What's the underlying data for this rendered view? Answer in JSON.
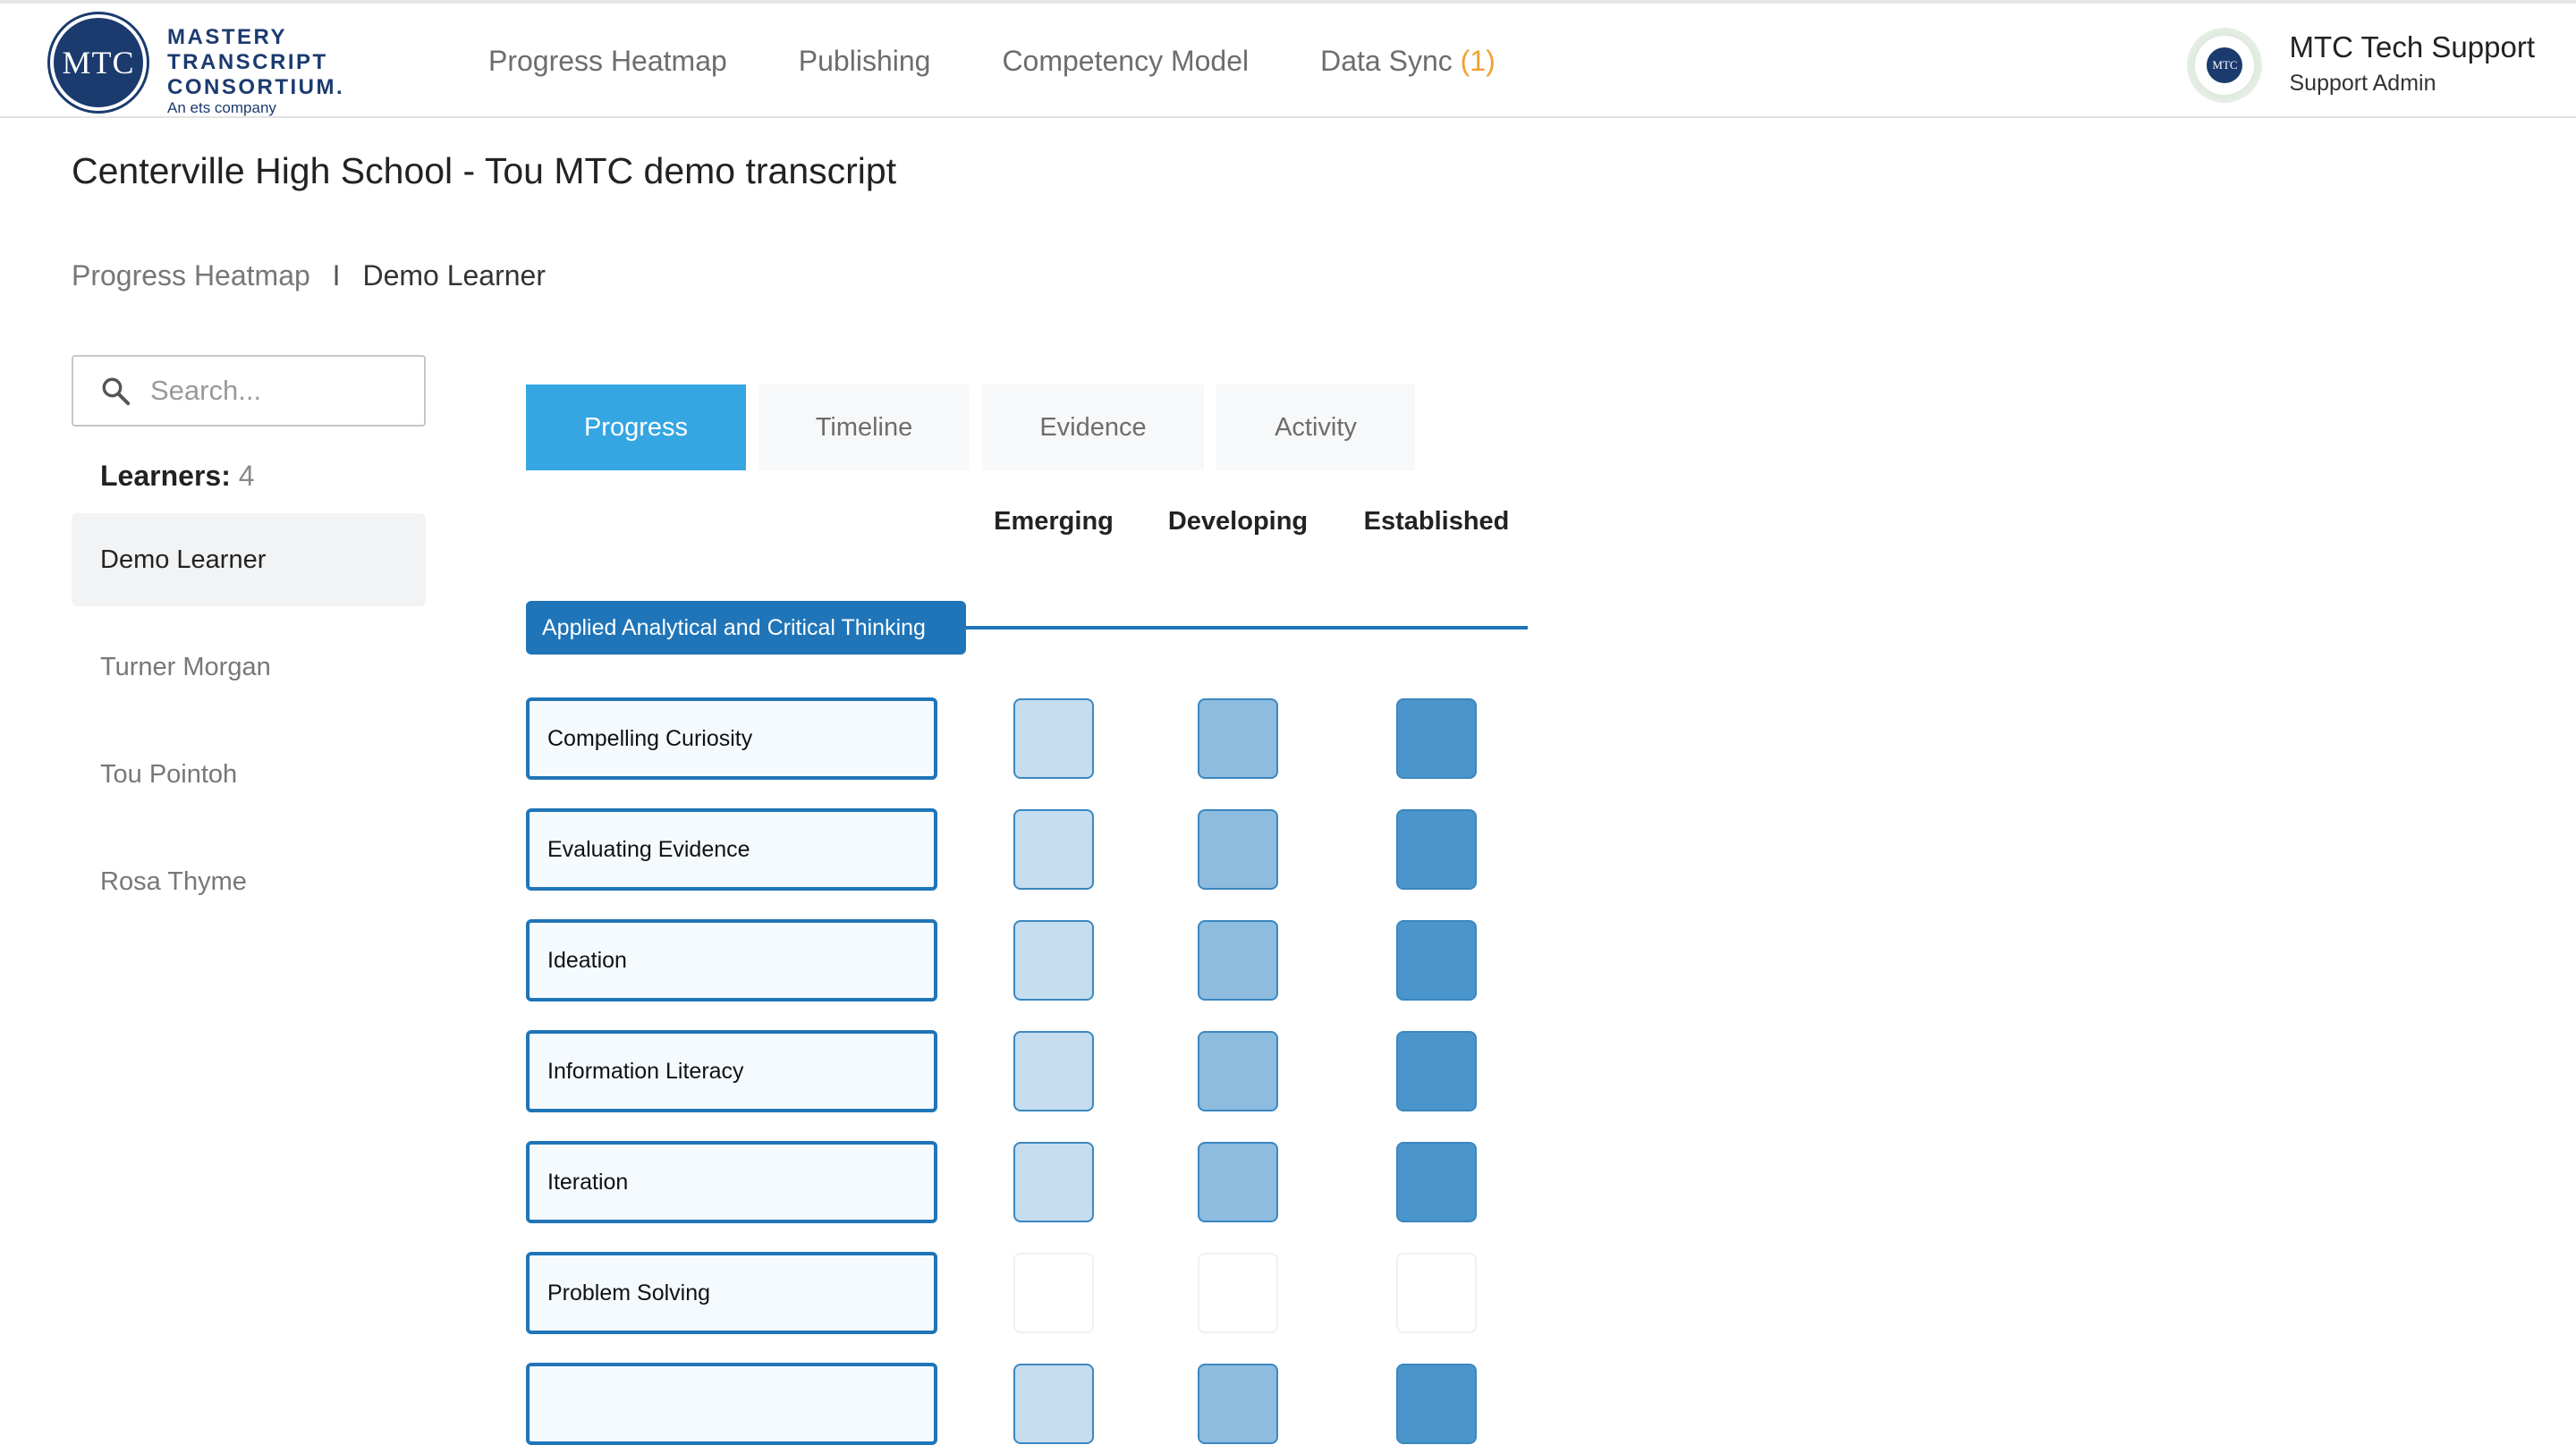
{
  "header": {
    "logo": {
      "badge": "MTC",
      "line1": "MASTERY",
      "line2": "TRANSCRIPT",
      "line3": "CONSORTIUM.",
      "sub": "An ets company"
    },
    "nav": [
      {
        "label": "Progress Heatmap"
      },
      {
        "label": "Publishing"
      },
      {
        "label": "Competency Model"
      },
      {
        "label": "Data Sync",
        "count": "(1)"
      }
    ],
    "user": {
      "avatar_text": "MTC",
      "name": "MTC Tech Support",
      "role": "Support Admin"
    }
  },
  "page": {
    "title": "Centerville High School - Tou MTC demo transcript"
  },
  "breadcrumb": {
    "link": "Progress Heatmap",
    "separator": "I",
    "current": "Demo Learner"
  },
  "sidebar": {
    "search_placeholder": "Search...",
    "learners_label": "Learners:",
    "learners_count": "4",
    "learners": [
      "Demo Learner",
      "Turner Morgan",
      "Tou Pointoh",
      "Rosa Thyme"
    ],
    "selected": "Demo Learner"
  },
  "tabs": [
    {
      "label": "Progress",
      "active": true
    },
    {
      "label": "Timeline",
      "active": false
    },
    {
      "label": "Evidence",
      "active": false
    },
    {
      "label": "Activity",
      "active": false
    }
  ],
  "heatmap": {
    "levels": [
      "Emerging",
      "Developing",
      "Established"
    ],
    "group": "Applied Analytical and Critical Thinking",
    "colors": {
      "emerging": "#c5ddef",
      "developing": "#8dbcdf",
      "established": "#4a95cb",
      "border": "#1f75b8"
    },
    "competencies": [
      {
        "name": "Compelling Curiosity",
        "filled": true
      },
      {
        "name": "Evaluating Evidence",
        "filled": true
      },
      {
        "name": "Ideation",
        "filled": true
      },
      {
        "name": "Information Literacy",
        "filled": true
      },
      {
        "name": "Iteration",
        "filled": true
      },
      {
        "name": "Problem Solving",
        "filled": false
      },
      {
        "name": "",
        "filled": true
      }
    ]
  }
}
